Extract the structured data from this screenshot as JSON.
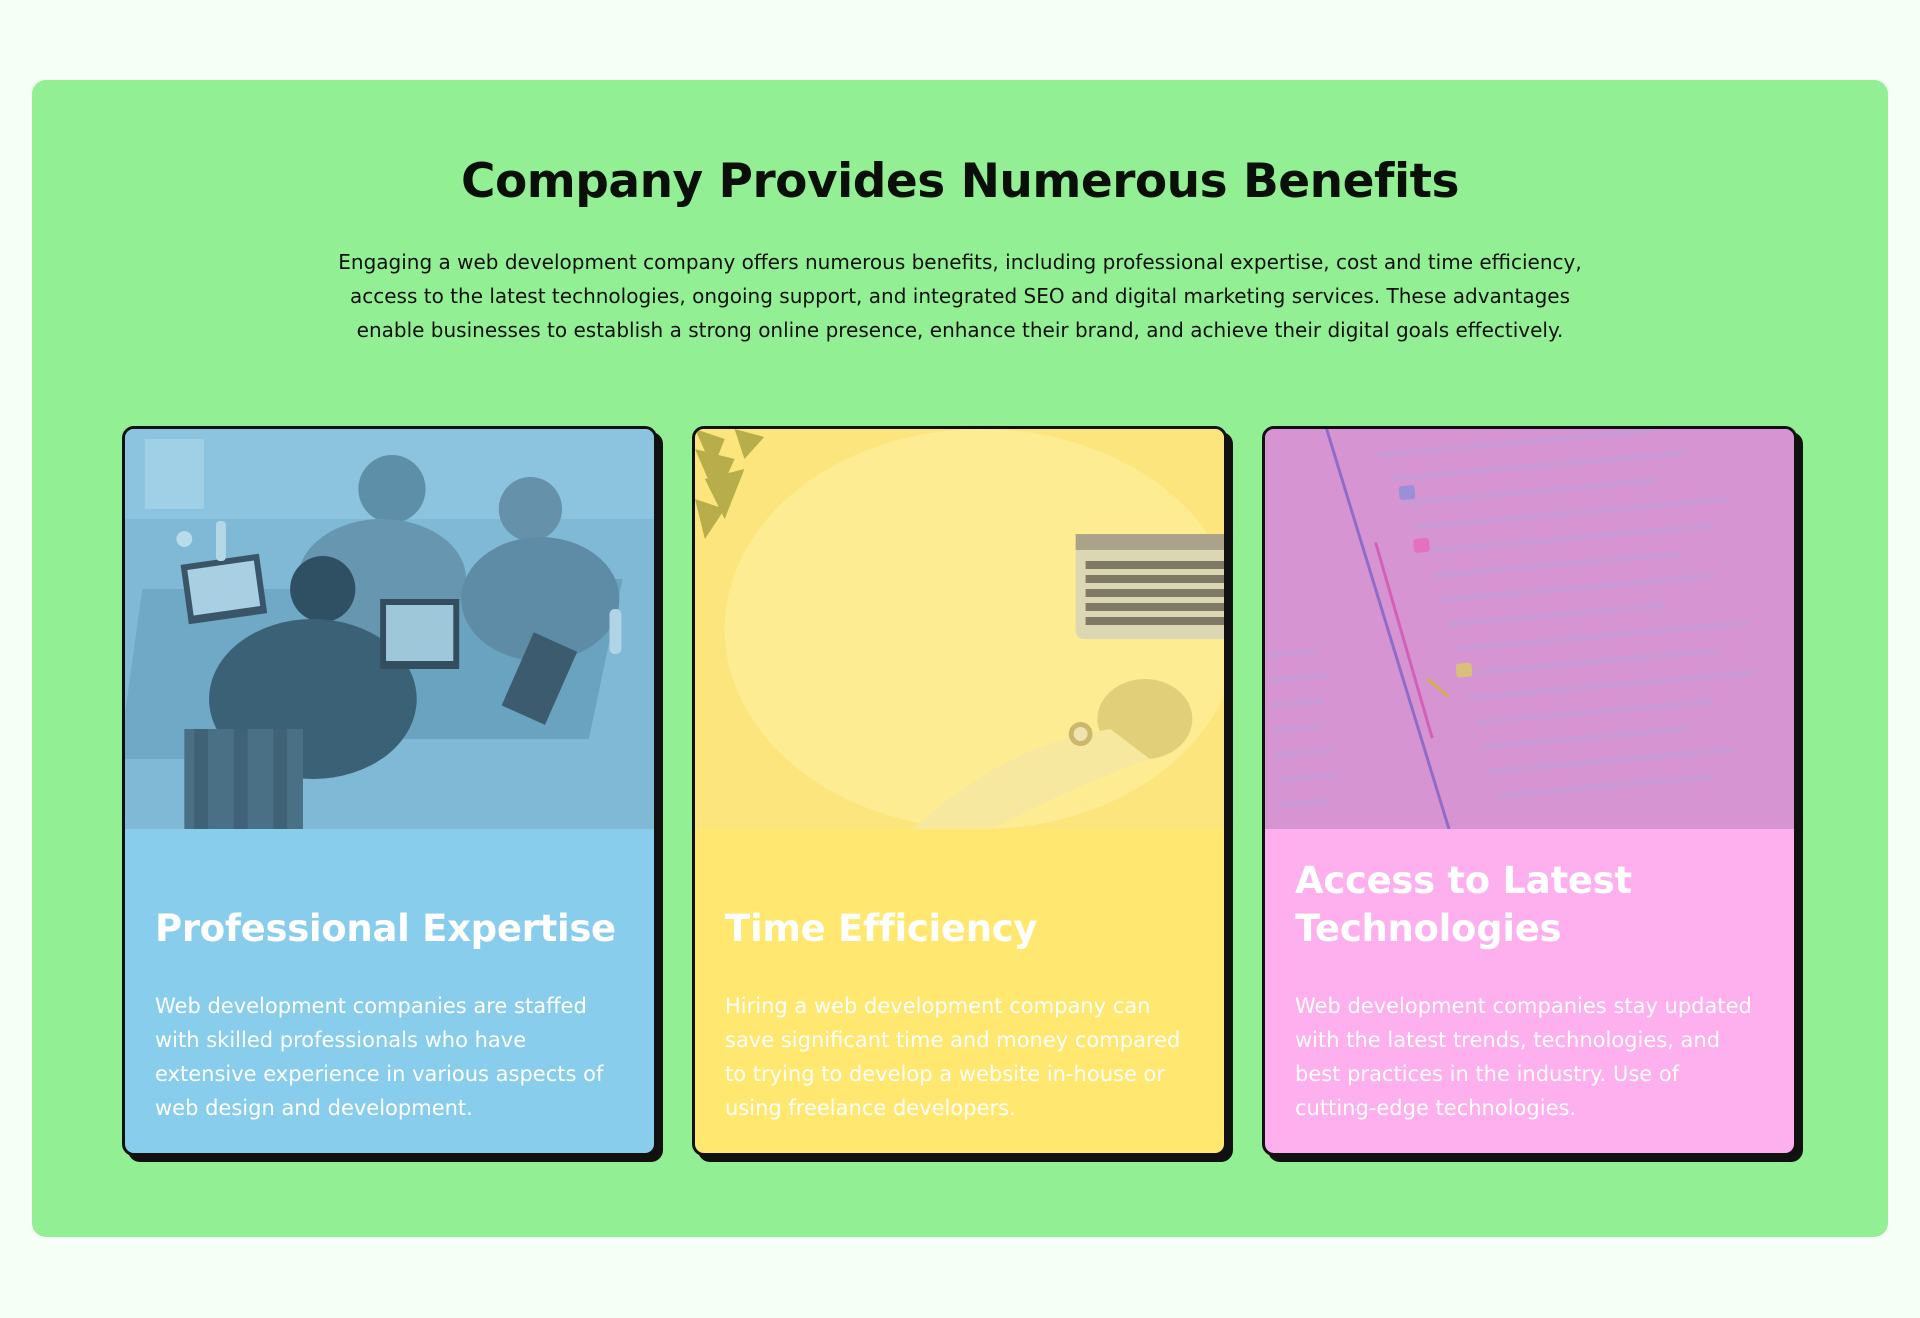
{
  "section": {
    "title": "Company Provides Numerous Benefits",
    "description": "Engaging a web development company offers numerous benefits, including professional expertise, cost and time efficiency, access to the latest technologies, ongoing support, and integrated SEO and digital marketing services. These advantages enable businesses to establish a strong online presence, enhance their brand, and achieve their digital goals effectively."
  },
  "colors": {
    "page_background": "#f6fff5",
    "section_background": "#93ef93",
    "card_blue": "#88cdec",
    "card_yellow": "#ffe770",
    "card_pink": "#feafee",
    "card_border": "#111111"
  },
  "cards": [
    {
      "title": "Professional Expertise",
      "text": "Web development companies are staffed with skilled professionals who have extensive experience in various aspects of web design and development.",
      "image_subject": "team-working-on-laptops"
    },
    {
      "title": "Time Efficiency",
      "text": "Hiring a web development company can save significant time and money compared to trying to develop a website in-house or using freelance developers.",
      "image_subject": "laptop-on-desk"
    },
    {
      "title": "Access to Latest Technologies",
      "text": "Web development companies stay updated with the latest trends, technologies, and best practices in the industry. Use of cutting-edge technologies.",
      "image_subject": "code-commit-history"
    }
  ]
}
